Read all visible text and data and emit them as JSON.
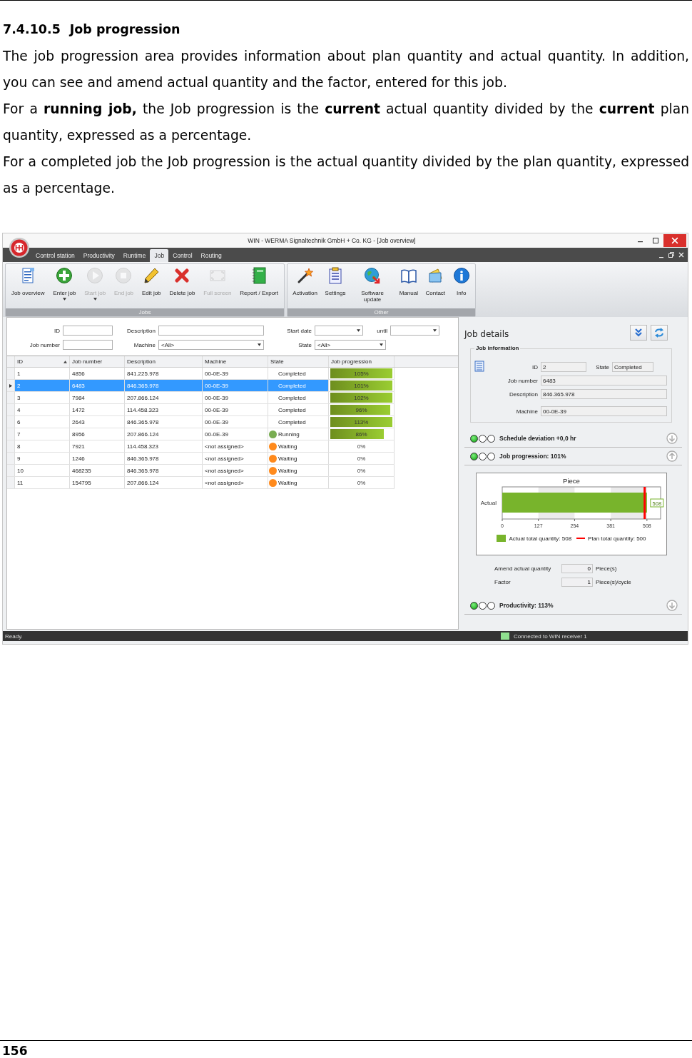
{
  "document": {
    "heading_number": "7.4.10.5",
    "heading": "Job progression",
    "paragraphs": [
      "The job progression area provides information about plan quantity and actual quantity. In addition, you can see and amend actual quantity and the factor, entered for this job.",
      "For a **running job,** the Job progression is the **current** actual quantity divided by the **current** plan quantity, expressed as a percentage.",
      "For a completed job the Job progression is the actual quantity divided by the plan quantity, expressed as a percentage."
    ],
    "page_number": "156"
  },
  "window": {
    "title": "WIN - WERMA Signaltechnik GmbH + Co. KG - [Job overview]"
  },
  "ribbon_tabs": [
    {
      "label": "Control station",
      "selected": false
    },
    {
      "label": "Productivity",
      "selected": false
    },
    {
      "label": "Runtime",
      "selected": false
    },
    {
      "label": "Job",
      "selected": true
    },
    {
      "label": "Control",
      "selected": false
    },
    {
      "label": "Routing",
      "selected": false
    }
  ],
  "ribbon_groups": [
    {
      "label": "Jobs",
      "items": [
        {
          "label": "Job overview",
          "disabled": false,
          "dropdown": false
        },
        {
          "label": "Enter job",
          "disabled": false,
          "dropdown": true
        },
        {
          "label": "Start job",
          "disabled": true,
          "dropdown": true
        },
        {
          "label": "End job",
          "disabled": true,
          "dropdown": false
        },
        {
          "label": "Edit job",
          "disabled": false,
          "dropdown": false
        },
        {
          "label": "Delete job",
          "disabled": false,
          "dropdown": false
        },
        {
          "label": "Full screen",
          "disabled": true,
          "dropdown": false
        },
        {
          "label": "Report / Export",
          "disabled": false,
          "dropdown": false
        }
      ]
    },
    {
      "label": "Other",
      "items": [
        {
          "label": "Activation",
          "disabled": false,
          "dropdown": false
        },
        {
          "label": "Settings",
          "disabled": false,
          "dropdown": false
        },
        {
          "label": "Software update",
          "disabled": false,
          "dropdown": false
        },
        {
          "label": "Manual",
          "disabled": false,
          "dropdown": false
        },
        {
          "label": "Contact",
          "disabled": false,
          "dropdown": false
        },
        {
          "label": "Info",
          "disabled": false,
          "dropdown": false
        }
      ]
    }
  ],
  "filters": [
    [
      {
        "label": "ID",
        "kind": "text"
      },
      {
        "label": "Description",
        "kind": "text"
      },
      {
        "label": "Start date",
        "kind": "combo"
      },
      {
        "label": "until",
        "kind": "combo"
      }
    ],
    [
      {
        "label": "Job number",
        "kind": "text"
      },
      {
        "label": "Machine",
        "kind": "combo",
        "value": "<All>"
      },
      {
        "label": "State",
        "kind": "combo",
        "value": "<All>"
      }
    ]
  ],
  "table": {
    "columns": [
      {
        "label": "ID",
        "sorted": true
      },
      {
        "label": "Job number"
      },
      {
        "label": "Description"
      },
      {
        "label": "Machine"
      },
      {
        "label": "State"
      },
      {
        "label": "Job progression"
      }
    ],
    "rows": [
      {
        "cells": [
          "1",
          "4856",
          "841.225.978",
          "00-0E-39"
        ],
        "state": {
          "text": "Completed"
        },
        "progression": {
          "text": "105%",
          "level": 1
        },
        "selected": false
      },
      {
        "cells": [
          "2",
          "6483",
          "846.365.978",
          "00-0E-39"
        ],
        "state": {
          "text": "Completed"
        },
        "progression": {
          "text": "101%",
          "level": 1
        },
        "selected": true
      },
      {
        "cells": [
          "3",
          "7984",
          "207.866.124",
          "00-0E-39"
        ],
        "state": {
          "text": "Completed"
        },
        "progression": {
          "text": "102%",
          "level": 1
        },
        "selected": false
      },
      {
        "cells": [
          "4",
          "1472",
          "114.458.323",
          "00-0E-39"
        ],
        "state": {
          "text": "Completed"
        },
        "progression": {
          "text": "96%",
          "level": 0.96
        },
        "selected": false
      },
      {
        "cells": [
          "6",
          "2643",
          "846.365.978",
          "00-0E-39"
        ],
        "state": {
          "text": "Completed"
        },
        "progression": {
          "text": "113%",
          "level": 1
        },
        "selected": false
      },
      {
        "cells": [
          "7",
          "8956",
          "207.866.124",
          "00-0E-39"
        ],
        "state": {
          "text": "Running",
          "color": "#79ad52"
        },
        "progression": {
          "text": "86%",
          "level": 0.86
        },
        "selected": false
      },
      {
        "cells": [
          "8",
          "7921",
          "114.458.323",
          "<not assigned>"
        ],
        "state": {
          "text": "Waiting",
          "color": "#ff8a1c"
        },
        "progression": {
          "text": "0%",
          "level": 0
        },
        "selected": false
      },
      {
        "cells": [
          "9",
          "1246",
          "846.365.978",
          "<not assigned>"
        ],
        "state": {
          "text": "Waiting",
          "color": "#ff8a1c"
        },
        "progression": {
          "text": "0%",
          "level": 0
        },
        "selected": false
      },
      {
        "cells": [
          "10",
          "468235",
          "846.365.978",
          "<not assigned>"
        ],
        "state": {
          "text": "Waiting",
          "color": "#ff8a1c"
        },
        "progression": {
          "text": "0%",
          "level": 0
        },
        "selected": false
      },
      {
        "cells": [
          "11",
          "154795",
          "207.866.124",
          "<not assigned>"
        ],
        "state": {
          "text": "Waiting",
          "color": "#ff8a1c"
        },
        "progression": {
          "text": "0%",
          "level": 0
        },
        "selected": false
      }
    ]
  },
  "details": {
    "title": "Job details",
    "info": {
      "title": "Job information",
      "rows": [
        [
          {
            "label": "ID",
            "value": "2"
          },
          {
            "label": "State",
            "value": "Completed"
          }
        ],
        [
          {
            "label": "Job number",
            "value": "6483"
          }
        ],
        [
          {
            "label": "Description",
            "value": "846.365.978"
          }
        ],
        [
          {
            "label": "Machine",
            "value": "00-0E-39"
          }
        ]
      ]
    },
    "sections": [
      {
        "title": "Schedule deviation +0,0 hr",
        "lights": [
          true,
          false,
          false
        ],
        "expanded": false
      },
      {
        "title": "Job progression: 101%",
        "lights": [
          true,
          false,
          false
        ],
        "expanded": true,
        "chart_data": {
          "type": "bar",
          "orientation": "horizontal",
          "title": "Piece",
          "categories": [
            "Actual"
          ],
          "series": [
            {
              "name": "Actual total quantity: 508",
              "color": "#78b42c",
              "values": [
                508
              ]
            }
          ],
          "xlim": [
            0,
            556
          ],
          "xticks": [
            0,
            127,
            254,
            381,
            508
          ],
          "data_labels": true,
          "legend": "bottom",
          "ref_lines": [
            {
              "axis": "x",
              "value": 500,
              "label": "Plan total quantity: 500",
              "color": "#ff0000"
            }
          ]
        },
        "fields": [
          {
            "label": "Amend actual quantity",
            "value": "0",
            "unit": "Piece(s)"
          },
          {
            "label": "Factor",
            "value": "1",
            "unit": "Piece(s)/cycle"
          }
        ]
      },
      {
        "title": "Productivity: 113%",
        "lights": [
          true,
          false,
          false
        ],
        "expanded": false
      }
    ]
  },
  "status_bar": {
    "text": "Ready.",
    "connection": {
      "text": "Connected to WIN receiver 1",
      "connected": true
    }
  }
}
